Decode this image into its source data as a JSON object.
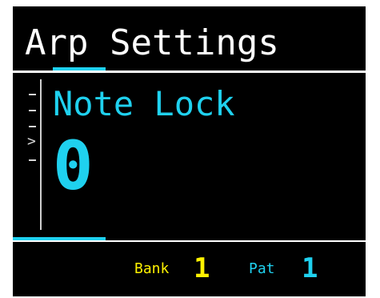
{
  "screen": {
    "title": "Arp Settings",
    "parameter": {
      "label": "Note Lock",
      "value": "0"
    },
    "menu": {
      "cursor_symbol": ">",
      "selected_index": 3,
      "item_count": 5
    },
    "status_bar": {
      "bank_label": "Bank",
      "bank_value": "1",
      "pattern_label": "Pat",
      "pattern_value": "1"
    },
    "colors": {
      "background": "#000000",
      "title_text": "#ffffff",
      "accent_cyan": "#1fd1ef",
      "accent_yellow": "#fff200"
    }
  }
}
